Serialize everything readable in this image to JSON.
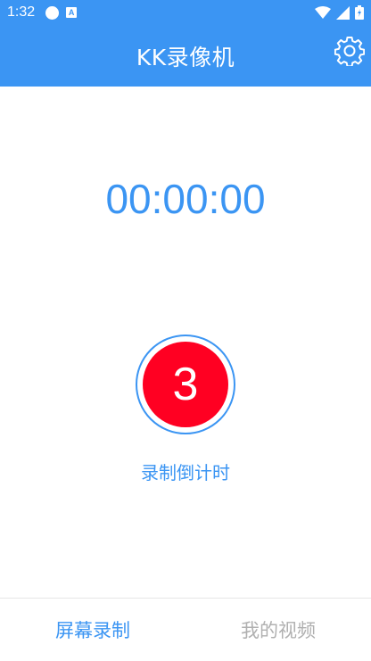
{
  "status_bar": {
    "time": "1:32",
    "icons": [
      "notification-dot-icon",
      "a-badge-icon",
      "wifi-icon",
      "signal-icon",
      "battery-icon"
    ]
  },
  "header": {
    "title": "KK录像机",
    "settings_icon": "gear-icon"
  },
  "timer": "00:00:00",
  "record_button": {
    "countdown": "3"
  },
  "caption": "录制倒计时",
  "tabs": [
    {
      "label": "屏幕录制",
      "active": true
    },
    {
      "label": "我的视频",
      "active": false
    }
  ],
  "colors": {
    "primary": "#3b95f3",
    "record": "#ff0022",
    "inactive_tab": "#b0b0b0"
  }
}
